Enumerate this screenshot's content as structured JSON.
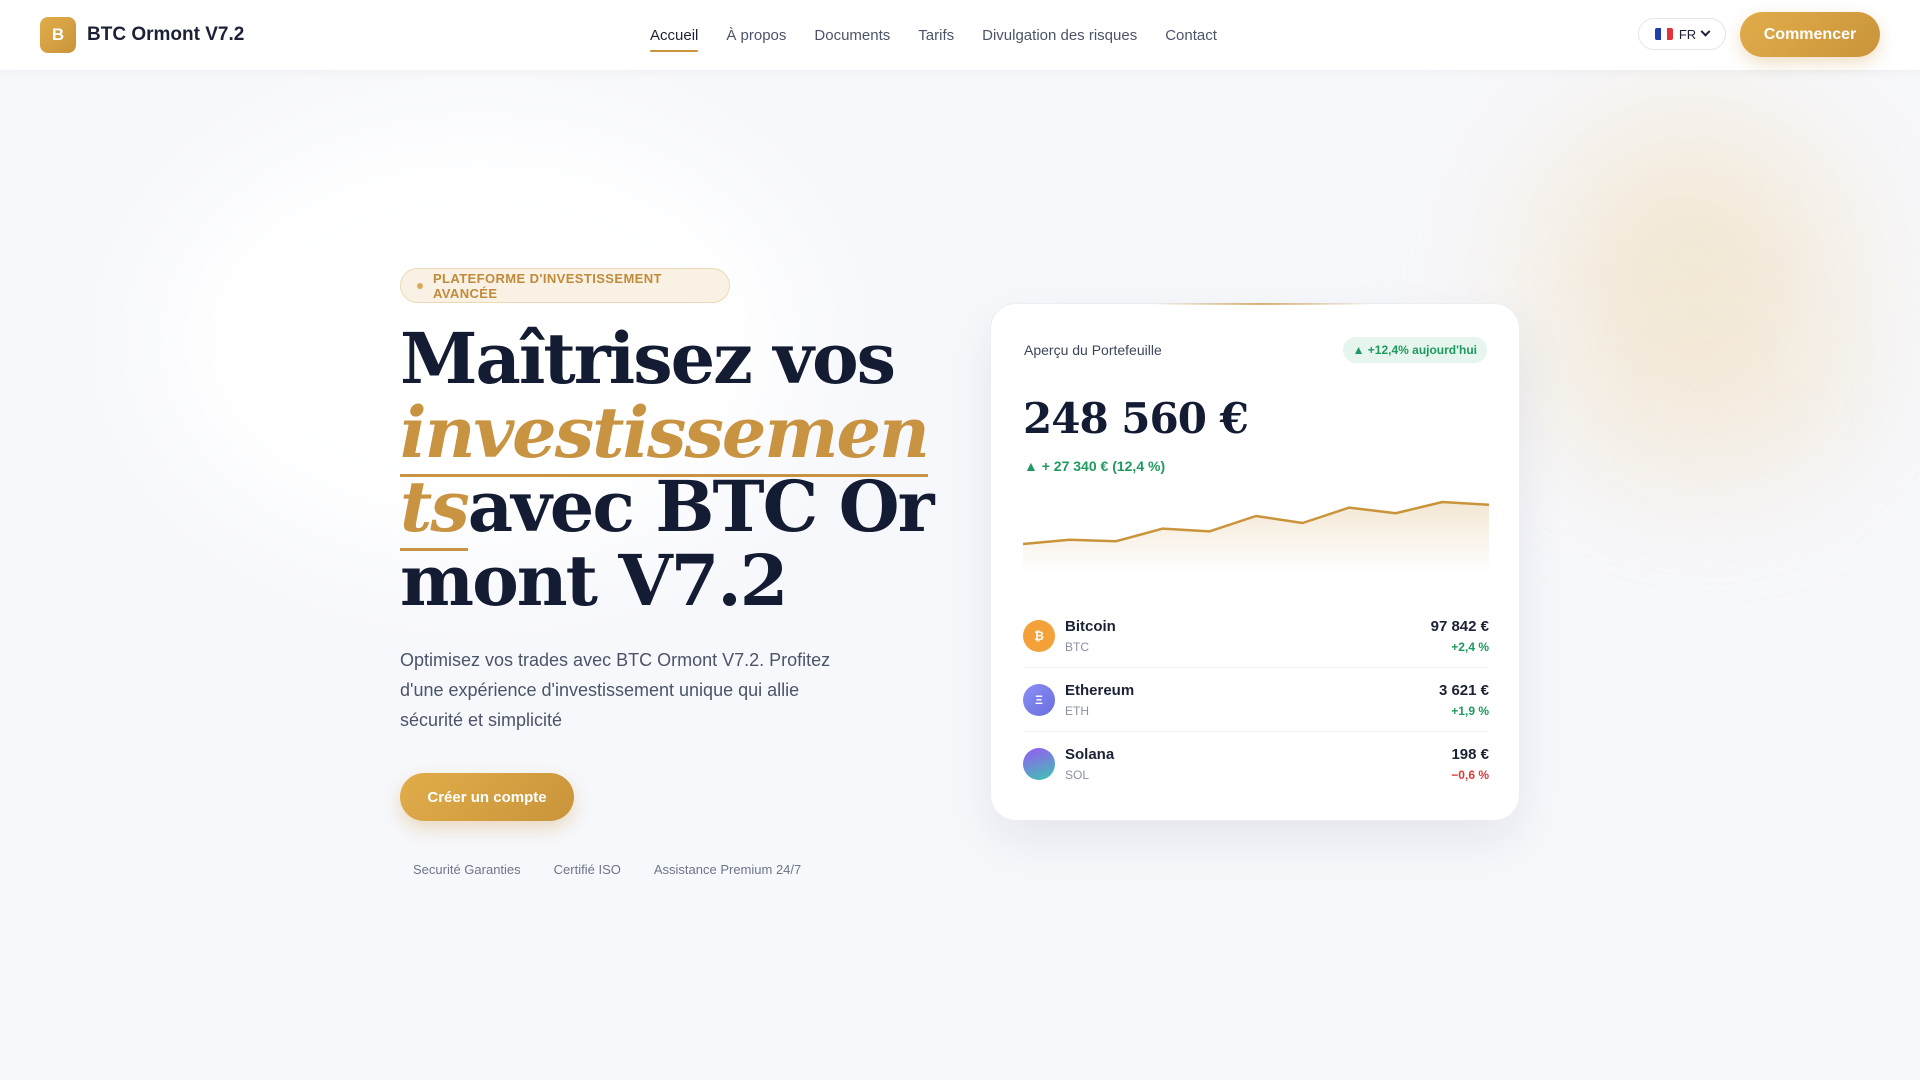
{
  "brand": {
    "logo_letter": "B",
    "name": "BTC Ormont V7.2"
  },
  "nav": {
    "items": [
      {
        "label": "Accueil",
        "active": true
      },
      {
        "label": "À propos"
      },
      {
        "label": "Documents"
      },
      {
        "label": "Tarifs"
      },
      {
        "label": "Divulgation des risques"
      },
      {
        "label": "Contact"
      }
    ],
    "language": "FR",
    "cta": "Commencer"
  },
  "hero": {
    "badge": "PLATEFORME D'INVESTISSEMENT AVANCÉE",
    "title_part1": "Maîtrisez vos ",
    "title_accent": "investissements",
    "title_part2": "avec BTC Ormont V7.2",
    "subtitle": "Optimisez vos trades avec BTC Ormont V7.2. Profitez d'une expérience d'investissement unique qui allie sécurité et simplicité",
    "cta": "Créer un compte",
    "trust": [
      "Securité Garanties",
      "Certifié ISO",
      "Assistance Premium 24/7"
    ]
  },
  "portfolio": {
    "label": "Aperçu du Portefeuille",
    "today": "▲ +12,4% aujourd'hui",
    "total": "248 560 €",
    "change": "▲ + 27 340 € (12,4 %)",
    "sparkline": [
      12,
      15,
      14,
      23,
      21,
      32,
      27,
      38,
      34,
      42,
      40
    ],
    "assets": [
      {
        "name": "Bitcoin",
        "symbol": "BTC",
        "icon": "bitcoin-icon",
        "glyph": "₿",
        "price": "97 842 €",
        "change": "+2,4 %",
        "positive": true,
        "color": "#f4a13a"
      },
      {
        "name": "Ethereum",
        "symbol": "ETH",
        "icon": "ethereum-icon",
        "glyph": "Ξ",
        "price": "3 621 €",
        "change": "+1,9 %",
        "positive": true,
        "color": "#7b7fe8"
      },
      {
        "name": "Solana",
        "symbol": "SOL",
        "icon": "solana-icon",
        "glyph": "",
        "price": "198 €",
        "change": "−0,6 %",
        "positive": false,
        "color": "#8a5cf0"
      }
    ]
  },
  "colors": {
    "accent": "#c9943a",
    "navy": "#141c33",
    "positive": "#1f9a5e",
    "negative": "#d63b3b"
  }
}
